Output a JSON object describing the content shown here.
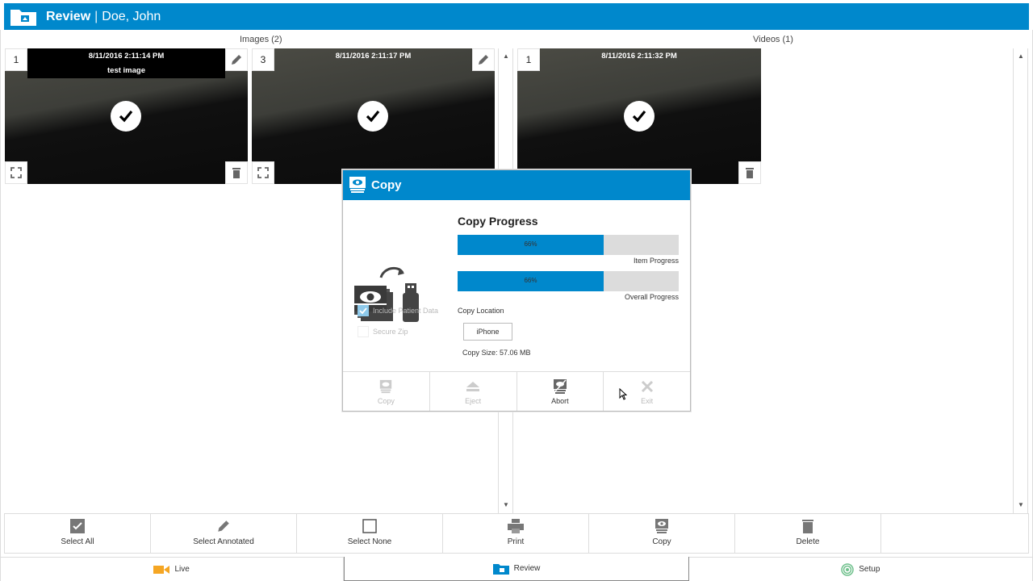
{
  "header": {
    "title": "Review",
    "separator": "|",
    "patient": "Doe, John"
  },
  "sections": {
    "images_label": "Images (2)",
    "videos_label": "Videos (1)"
  },
  "images": [
    {
      "number": "1",
      "timestamp": "8/11/2016 2:11:14 PM",
      "caption": "test image"
    },
    {
      "number": "3",
      "timestamp": "8/11/2016 2:11:17 PM"
    }
  ],
  "videos": [
    {
      "number": "1",
      "timestamp": "8/11/2016 2:11:32 PM"
    }
  ],
  "toolbar": {
    "select_all": "Select All",
    "select_annotated": "Select Annotated",
    "select_none": "Select None",
    "print": "Print",
    "copy": "Copy",
    "delete": "Delete"
  },
  "tabs": {
    "live": "Live",
    "review": "Review",
    "setup": "Setup"
  },
  "dialog": {
    "title": "Copy",
    "progress_title": "Copy Progress",
    "item_progress": {
      "label": "Item Progress",
      "value_text": "66%",
      "fraction": 0.66
    },
    "overall_progress": {
      "label": "Overall Progress",
      "value_text": "66%",
      "fraction": 0.66
    },
    "include_patient_data": "Include Patient Data",
    "secure_zip": "Secure Zip",
    "copy_location_label": "Copy Location",
    "copy_location_value": "iPhone",
    "copy_size": "Copy Size: 57.06 MB",
    "actions": {
      "copy": "Copy",
      "eject": "Eject",
      "abort": "Abort",
      "exit": "Exit"
    }
  },
  "colors": {
    "accent": "#0088cc",
    "progress_track": "#dcdcdc",
    "disabled_text": "#bbbbbb"
  },
  "icons": {
    "header": "folder-icon",
    "check": "check-icon",
    "pencil": "pencil-icon",
    "expand": "expand-icon",
    "trash": "trash-icon",
    "live": "camera-icon",
    "setup": "target-icon"
  }
}
